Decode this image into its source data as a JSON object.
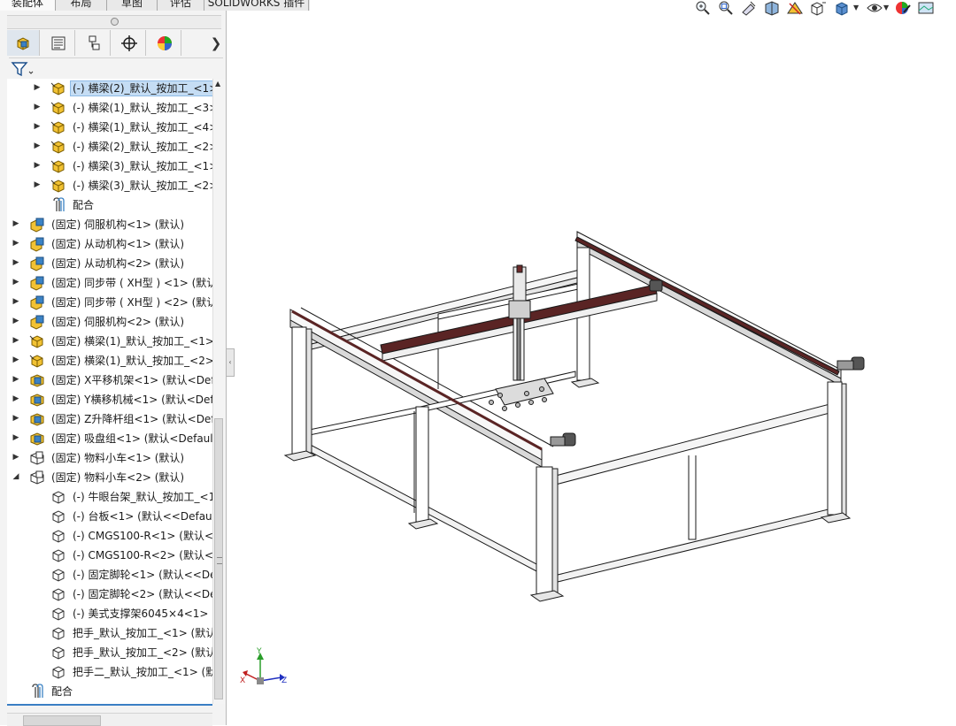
{
  "tabs": [
    {
      "label": "装配体",
      "active": true
    },
    {
      "label": "布局",
      "active": false
    },
    {
      "label": "草图",
      "active": false
    },
    {
      "label": "评估",
      "active": false
    },
    {
      "label": "SOLIDWORKS 插件",
      "active": false
    }
  ],
  "manager_icons": [
    "featuremanager-icon",
    "propertymanager-icon",
    "configurationmanager-icon",
    "dimxpert-icon",
    "display-manager-icon"
  ],
  "tree": {
    "items": [
      {
        "indent": 1,
        "expander": "collapsed",
        "icon": "part",
        "label": "(-) 横梁(2)_默认_按加工_<1>",
        "selected": true
      },
      {
        "indent": 1,
        "expander": "collapsed",
        "icon": "part",
        "label": "(-) 横梁(1)_默认_按加工_<3>"
      },
      {
        "indent": 1,
        "expander": "collapsed",
        "icon": "part",
        "label": "(-) 横梁(1)_默认_按加工_<4>"
      },
      {
        "indent": 1,
        "expander": "collapsed",
        "icon": "part",
        "label": "(-) 横梁(2)_默认_按加工_<2>"
      },
      {
        "indent": 1,
        "expander": "collapsed",
        "icon": "part",
        "label": "(-) 横梁(3)_默认_按加工_<1>"
      },
      {
        "indent": 1,
        "expander": "collapsed",
        "icon": "part",
        "label": "(-) 横梁(3)_默认_按加工_<2>"
      },
      {
        "indent": 1,
        "expander": "none",
        "icon": "mates",
        "label": "配合"
      },
      {
        "indent": 0,
        "expander": "collapsed",
        "icon": "assembly",
        "label": "(固定) 伺服机构<1> (默认)"
      },
      {
        "indent": 0,
        "expander": "collapsed",
        "icon": "assembly",
        "label": "(固定) 从动机构<1> (默认)"
      },
      {
        "indent": 0,
        "expander": "collapsed",
        "icon": "assembly",
        "label": "(固定) 从动机构<2> (默认)"
      },
      {
        "indent": 0,
        "expander": "collapsed",
        "icon": "assembly",
        "label": "(固定) 同步带 ( XH型 ) <1> (默认"
      },
      {
        "indent": 0,
        "expander": "collapsed",
        "icon": "assembly",
        "label": "(固定) 同步带 ( XH型 ) <2> (默认"
      },
      {
        "indent": 0,
        "expander": "collapsed",
        "icon": "assembly",
        "label": "(固定) 伺服机构<2> (默认)"
      },
      {
        "indent": 0,
        "expander": "collapsed",
        "icon": "part",
        "label": "(固定) 横梁(1)_默认_按加工_<1> ("
      },
      {
        "indent": 0,
        "expander": "collapsed",
        "icon": "part",
        "label": "(固定) 横梁(1)_默认_按加工_<2> ("
      },
      {
        "indent": 0,
        "expander": "collapsed",
        "icon": "assembly-blue",
        "label": "(固定) X平移机架<1> (默认<Defa"
      },
      {
        "indent": 0,
        "expander": "collapsed",
        "icon": "assembly-blue",
        "label": "(固定) Y横移机械<1> (默认<Defa"
      },
      {
        "indent": 0,
        "expander": "collapsed",
        "icon": "assembly-blue",
        "label": "(固定) Z升降杆组<1> (默认<Defa"
      },
      {
        "indent": 0,
        "expander": "collapsed",
        "icon": "assembly-blue",
        "label": "(固定) 吸盘组<1> (默认<Default_"
      },
      {
        "indent": 0,
        "expander": "collapsed",
        "icon": "assembly-outline",
        "label": "(固定) 物料小车<1> (默认)"
      },
      {
        "indent": 0,
        "expander": "expanded",
        "icon": "assembly-outline",
        "label": "(固定) 物料小车<2> (默认)"
      },
      {
        "indent": 1,
        "expander": "none",
        "icon": "part-outline",
        "label": "(-) 牛眼台架_默认_按加工_<1:"
      },
      {
        "indent": 1,
        "expander": "none",
        "icon": "part-outline",
        "label": "(-) 台板<1> (默认<<Default"
      },
      {
        "indent": 1,
        "expander": "none",
        "icon": "part-outline",
        "label": "(-) CMGS100-R<1> (默认<<"
      },
      {
        "indent": 1,
        "expander": "none",
        "icon": "part-outline",
        "label": "(-) CMGS100-R<2> (默认<<"
      },
      {
        "indent": 1,
        "expander": "none",
        "icon": "part-outline",
        "label": "(-) 固定脚轮<1> (默认<<Def"
      },
      {
        "indent": 1,
        "expander": "none",
        "icon": "part-outline",
        "label": "(-) 固定脚轮<2> (默认<<Def"
      },
      {
        "indent": 1,
        "expander": "none",
        "icon": "part-outline",
        "label": "(-) 美式支撑架6045×4<1> (默"
      },
      {
        "indent": 1,
        "expander": "none",
        "icon": "part-outline",
        "label": "把手_默认_按加工_<1> (默认)"
      },
      {
        "indent": 1,
        "expander": "none",
        "icon": "part-outline",
        "label": "把手_默认_按加工_<2> (默认)"
      },
      {
        "indent": 1,
        "expander": "none",
        "icon": "part-outline",
        "label": "把手二_默认_按加工_<1> (默认"
      },
      {
        "indent": 0,
        "expander": "none",
        "icon": "mates",
        "label": "配合"
      }
    ]
  },
  "toolbar_icons": [
    "zoom-to-fit-icon",
    "zoom-to-area-icon",
    "previous-view-icon",
    "section-view-icon",
    "dynamic-annotation-icon",
    "view-orientation-icon",
    "display-style-icon",
    "hide-show-icon",
    "edit-appearance-icon"
  ],
  "triad": {
    "x": "X",
    "y": "Y",
    "z": "Z"
  },
  "colors": {
    "selection": "#c5ddf4",
    "part_icon": "#f2c233",
    "assembly_icon": "#3b82c4",
    "rail": "#5a2424"
  }
}
